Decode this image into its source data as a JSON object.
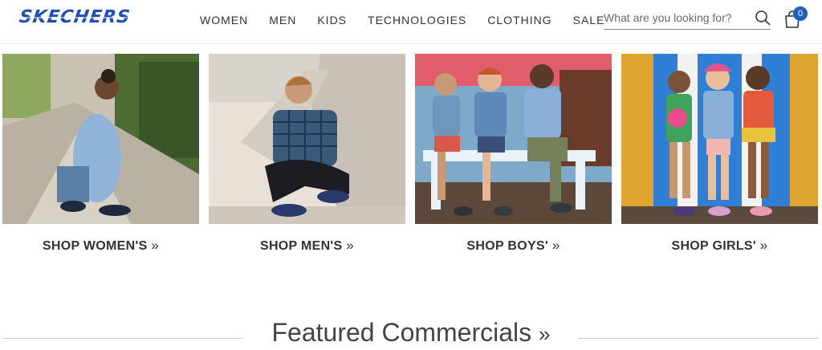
{
  "brand": {
    "logo": "SKECHERS"
  },
  "nav": {
    "items": [
      "WOMEN",
      "MEN",
      "KIDS",
      "TECHNOLOGIES",
      "CLOTHING",
      "SALE"
    ]
  },
  "search": {
    "placeholder": "What are you looking for?",
    "icon": "search-icon"
  },
  "cart": {
    "count": "0",
    "icon": "shopping-bag-icon",
    "badge_color": "#1f5fbf"
  },
  "categories": [
    {
      "label": "SHOP WOMEN'S",
      "image": "woman-tying-shoe-photo"
    },
    {
      "label": "SHOP MEN'S",
      "image": "man-crouching-photo"
    },
    {
      "label": "SHOP BOYS'",
      "image": "boys-on-bench-photo"
    },
    {
      "label": "SHOP GIRLS'",
      "image": "girls-standing-photo"
    }
  ],
  "chevron": "»",
  "featured": {
    "title": "Featured Commercials"
  },
  "colors": {
    "brand_blue": "#1f4fb5",
    "text": "#333333"
  }
}
